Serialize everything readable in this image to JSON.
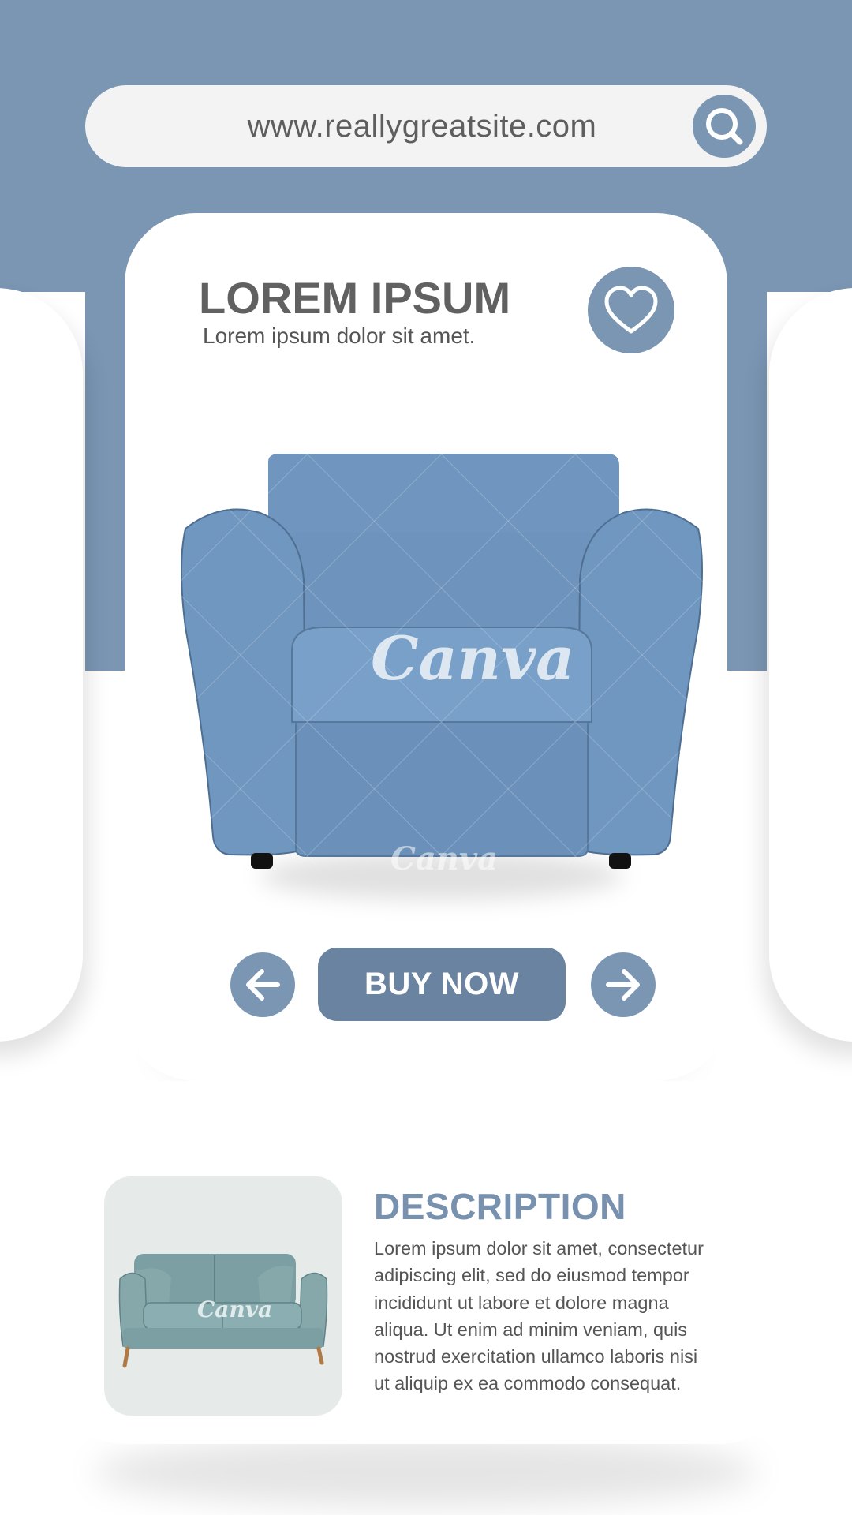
{
  "browser": {
    "url": "www.reallygreatsite.com",
    "search_icon": "search-icon"
  },
  "product": {
    "title": "LOREM IPSUM",
    "subtitle": "Lorem ipsum dolor sit amet.",
    "favorite_icon": "heart-icon",
    "image": "blue-armchair",
    "watermark": "Canva"
  },
  "actions": {
    "prev_icon": "arrow-left-icon",
    "buy_label": "BUY NOW",
    "next_icon": "arrow-right-icon"
  },
  "description": {
    "title": "DESCRIPTION",
    "lines": [
      "Lorem ipsum dolor sit amet, consectetur",
      "adipiscing elit, sed do eiusmod tempor",
      "incididunt ut labore et dolore magna",
      "aliqua. Ut enim ad minim veniam, quis",
      "nostrud exercitation ullamco laboris nisi",
      "ut aliquip ex ea commodo consequat."
    ],
    "image": "blue-sofa",
    "watermark": "Canva"
  },
  "colors": {
    "accent": "#7a96b3",
    "button": "#6a83a0",
    "title_gray": "#616161",
    "description_title": "#7891ae"
  }
}
